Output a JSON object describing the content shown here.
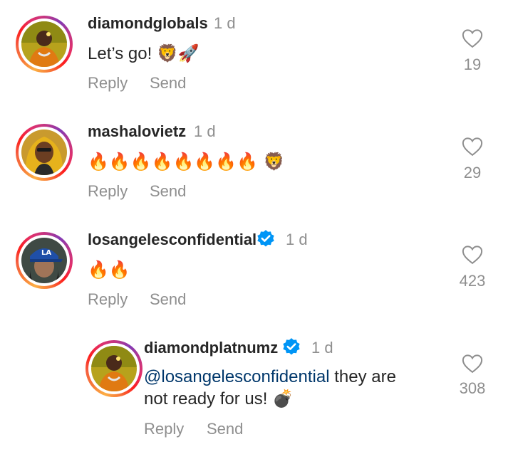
{
  "comments": [
    {
      "username": "diamondglobals",
      "time": "1 d",
      "text": "Let’s go! ",
      "emoji": "🦁🚀",
      "reply": "Reply",
      "send": "Send",
      "likes": "19"
    },
    {
      "username": "mashalovietz",
      "time": "1 d",
      "text": "",
      "emoji": "🔥🔥🔥🔥🔥🔥🔥🔥 🦁",
      "reply": "Reply",
      "send": "Send",
      "likes": "29"
    },
    {
      "username": "losangelesconfidential",
      "time": "1 d",
      "verified": true,
      "text": "",
      "emoji": "🔥🔥",
      "reply": "Reply",
      "send": "Send",
      "likes": "423"
    }
  ],
  "reply_comment": {
    "username": "diamondplatnumz",
    "time": "1 d",
    "verified": true,
    "mention": "@losangelesconfidential",
    "text_line1": " they are",
    "text_line2": "not ready for us! ",
    "emoji": "💣",
    "reply": "Reply",
    "send": "Send",
    "likes": "308"
  },
  "colors": {
    "text": "#262626",
    "secondary": "#8e8e8e",
    "mention": "#00376b",
    "verified": "#0095f6"
  },
  "icons": {
    "like": "heart-outline-icon",
    "verified": "verified-badge-icon"
  }
}
